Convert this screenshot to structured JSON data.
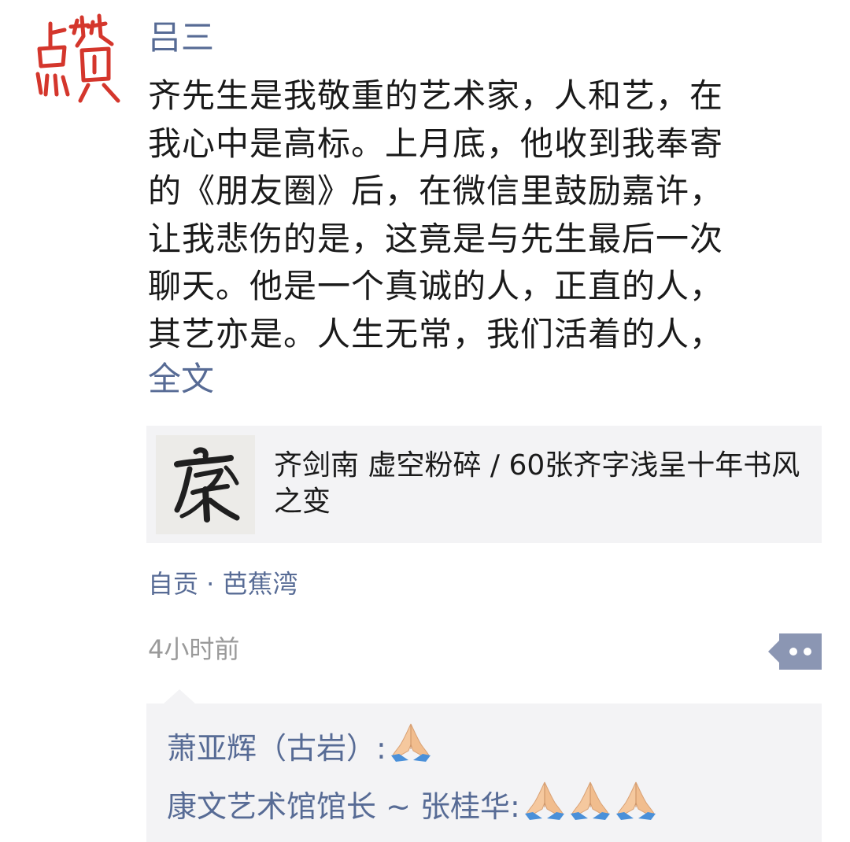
{
  "post": {
    "username": "吕三",
    "text_lines": [
      "齐先生是我敬重的艺术家，人和艺，在",
      "我心中是高标。上月底，他收到我奉寄",
      "的《朋友圈》后，在微信里鼓励嘉许，",
      "让我悲伤的是，这竟是与先生最后一次",
      "聊天。他是一个真诚的人，正直的人，",
      "其艺亦是。人生无常，我们活着的人，"
    ],
    "full_text_link": "全文",
    "share_card": {
      "title": "齐剑南  虚空粉碎  / 60张齐字浅呈十年书风之变"
    },
    "source": "自贡 · 芭蕉湾",
    "time": "4小时前"
  },
  "comments": [
    {
      "name": "萧亚辉（古岩）",
      "separator": ":",
      "emoji_count": 1
    },
    {
      "name": "康文艺术馆馆长 ~ 张桂华",
      "separator": ":",
      "emoji_count": 3
    }
  ],
  "icons": {
    "avatar": "zan-calligraphy-avatar",
    "thumb": "calligraphy-thumbnail",
    "more": "more-actions-icon",
    "emoji": "folded-hands-emoji"
  },
  "colors": {
    "link": "#576b95",
    "text": "#1a1a1a",
    "muted": "#9a9a9a",
    "card_bg": "#f3f3f5",
    "more_btn": "#8b96b3"
  }
}
